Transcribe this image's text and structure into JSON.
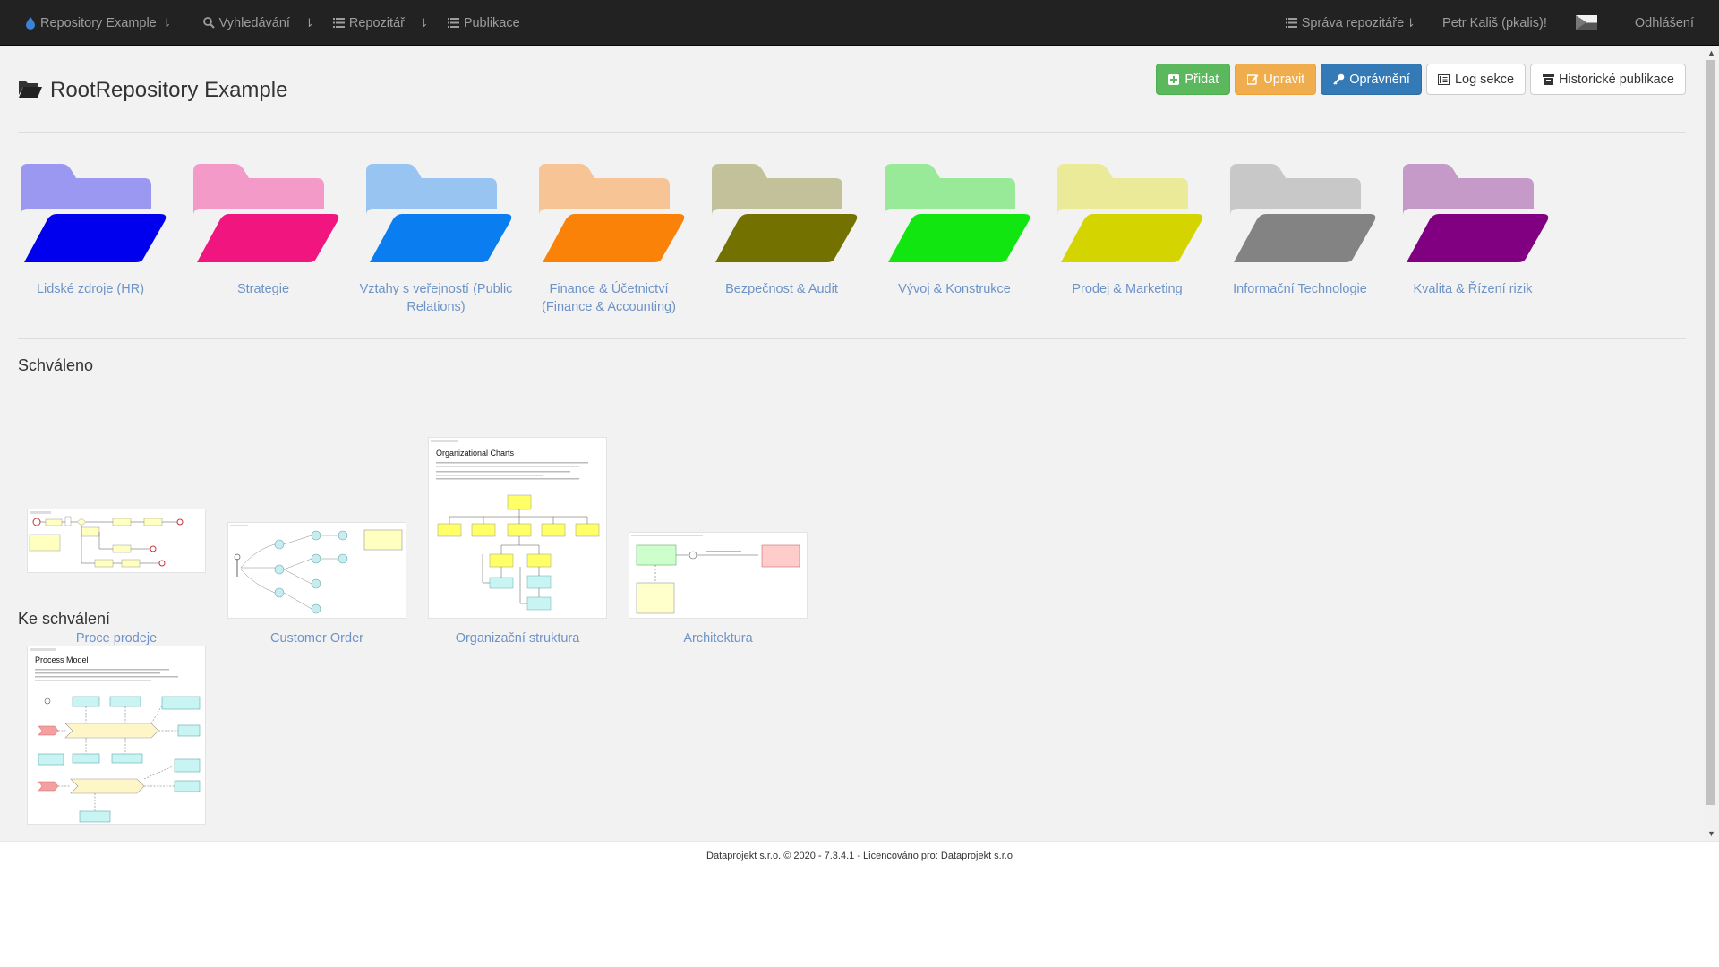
{
  "navbar": {
    "brand": "Repository Example",
    "search": "Vyhledávání",
    "repository": "Repozitář",
    "publications": "Publikace",
    "repo_admin": "Správa repozitáře",
    "user": "Petr Kališ (pkalis)!",
    "logout": "Odhlášení"
  },
  "page": {
    "title": "RootRepository Example"
  },
  "toolbar": {
    "add": "Přidat",
    "edit": "Upravit",
    "permissions": "Oprávnění",
    "log": "Log sekce",
    "history": "Historické publikace"
  },
  "folders": [
    {
      "label": "Lidské zdroje (HR)",
      "back": "#9a98f0",
      "front": "#0000ee"
    },
    {
      "label": "Strategie",
      "back": "#f49ac8",
      "front": "#f0157f"
    },
    {
      "label": "Vztahy s veřejností (Public Relations)",
      "back": "#98c4f2",
      "front": "#0a7ef0"
    },
    {
      "label": "Finance & Účetnictví (Finance & Accounting)",
      "back": "#f6c495",
      "front": "#fa8209"
    },
    {
      "label": "Bezpečnost & Audit",
      "back": "#c2c19a",
      "front": "#737200"
    },
    {
      "label": "Vývoj & Konstrukce",
      "back": "#98ea98",
      "front": "#11e611"
    },
    {
      "label": "Prodej & Marketing",
      "back": "#eaea98",
      "front": "#d4d400"
    },
    {
      "label": "Informační Technologie",
      "back": "#c8c8c8",
      "front": "#838383"
    },
    {
      "label": "Kvalita & Řízení rizik",
      "back": "#c69ac8",
      "front": "#800081"
    }
  ],
  "sections": {
    "approved": "Schváleno",
    "pending": "Ke schválení"
  },
  "approved_models": [
    {
      "label": "Proce prodeje"
    },
    {
      "label": "Customer Order"
    },
    {
      "label": "Organizační struktura",
      "heading": "Organizational Charts"
    },
    {
      "label": "Architektura"
    }
  ],
  "pending_models": [
    {
      "label": "",
      "heading": "Process Model"
    }
  ],
  "footer": {
    "text": "Dataprojekt s.r.o. © 2020 - 7.3.4.1 - Licencováno pro: Dataprojekt s.r.o"
  }
}
